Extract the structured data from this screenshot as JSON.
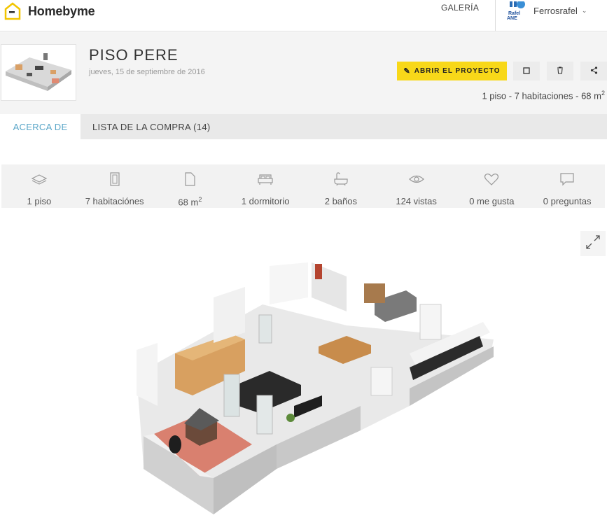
{
  "header": {
    "brand": "Homebyme",
    "nav_galeria": "GALERÍA",
    "user_name": "Ferrosrafel",
    "avatar_text": "Rafel\nANE"
  },
  "project": {
    "title": "PISO PERE",
    "date": "jueves, 15 de septiembre de 2016",
    "open_label": "ABRIR EL PROYECTO",
    "summary_prefix": "1 piso - 7 habitaciones - 68 m",
    "summary_sup": "2"
  },
  "tabs": [
    {
      "label": "ACERCA DE",
      "active": true
    },
    {
      "label": "LISTA DE LA COMPRA (14)",
      "active": false
    }
  ],
  "stats": [
    {
      "icon": "floor-layers-icon",
      "label": "1 piso"
    },
    {
      "icon": "door-icon",
      "label": "7 habitaciónes"
    },
    {
      "icon": "area-page-icon",
      "label": "68 m",
      "sup": "2"
    },
    {
      "icon": "bed-icon",
      "label": "1 dormitorio"
    },
    {
      "icon": "bathtub-icon",
      "label": "2 baños"
    },
    {
      "icon": "eye-icon",
      "label": "124 vistas"
    },
    {
      "icon": "heart-icon",
      "label": "0 me gusta"
    },
    {
      "icon": "comment-icon",
      "label": "0 preguntas"
    }
  ],
  "colors": {
    "accent_yellow": "#f8d819",
    "tab_active_text": "#5aa6c8",
    "header_bg": "#f4f4f4"
  }
}
